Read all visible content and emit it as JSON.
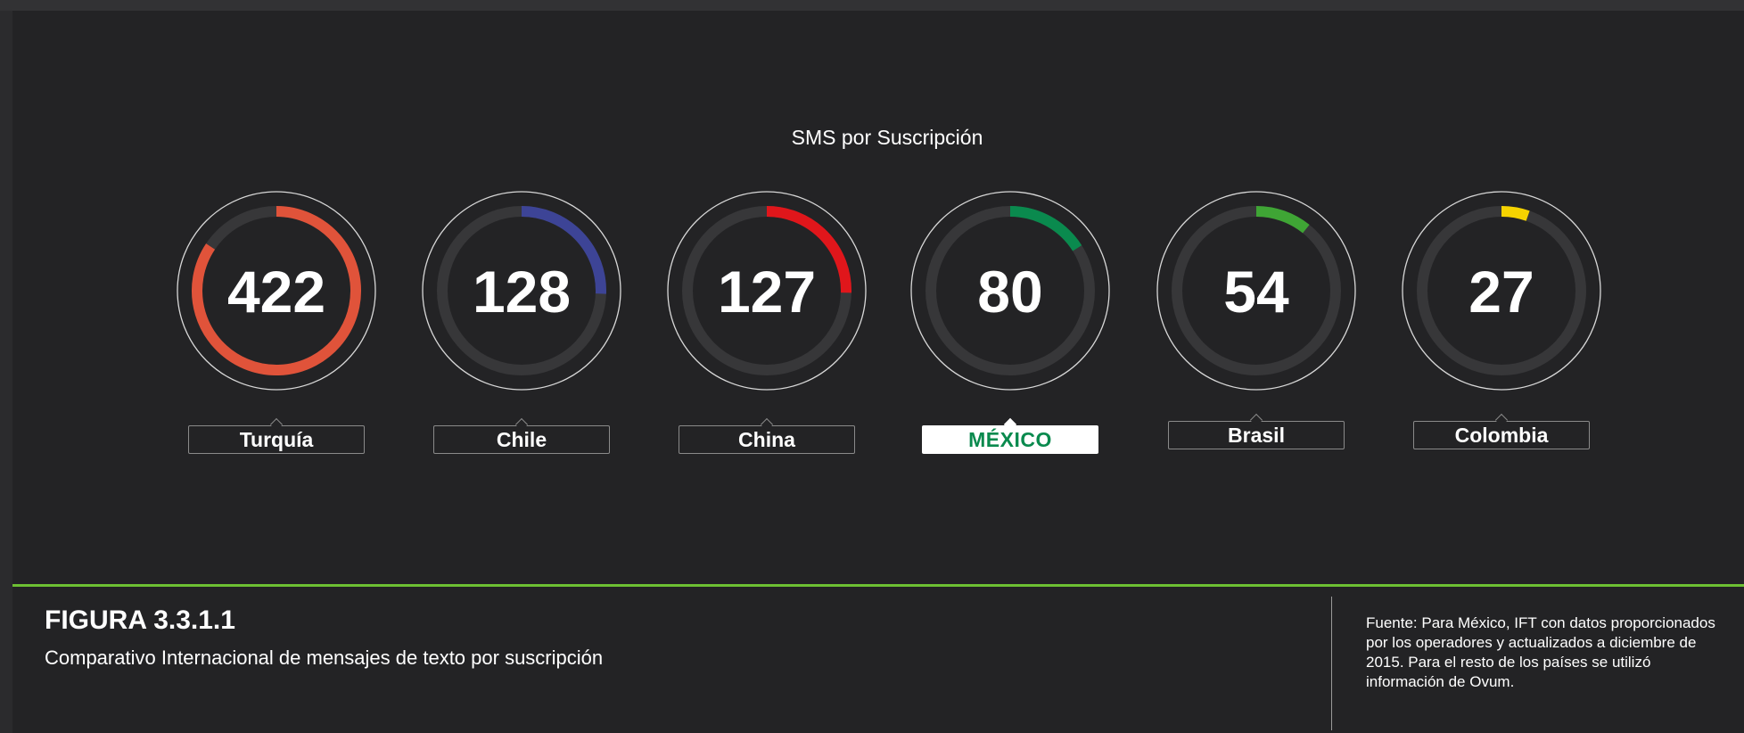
{
  "chart_data": {
    "type": "gauge",
    "title": "SMS por Suscripción",
    "max": 500,
    "track_color": "#373739",
    "items": [
      {
        "label": "Turquía",
        "value": 422,
        "color": "#e0533a",
        "highlight": false
      },
      {
        "label": "Chile",
        "value": 128,
        "color": "#3d4496",
        "highlight": false
      },
      {
        "label": "China",
        "value": 127,
        "color": "#e0161b",
        "highlight": false
      },
      {
        "label": "MÉXICO",
        "value": 80,
        "color": "#0a8a4e",
        "highlight": true
      },
      {
        "label": "Brasil",
        "value": 54,
        "color": "#3fa535",
        "highlight": false
      },
      {
        "label": "Colombia",
        "value": 27,
        "color": "#f5d300",
        "highlight": false
      }
    ]
  },
  "caption": {
    "code": "FIGURA 3.3.1.1",
    "description": "Comparativo Internacional de mensajes de texto por suscripción",
    "source": "Fuente: Para México, IFT con datos proporcionados por los operadores y actualizados a diciembre de 2015. Para el resto de los países se utilizó información de Ovum."
  },
  "colors": {
    "accent_line": "#6dc033",
    "background": "#232325"
  }
}
